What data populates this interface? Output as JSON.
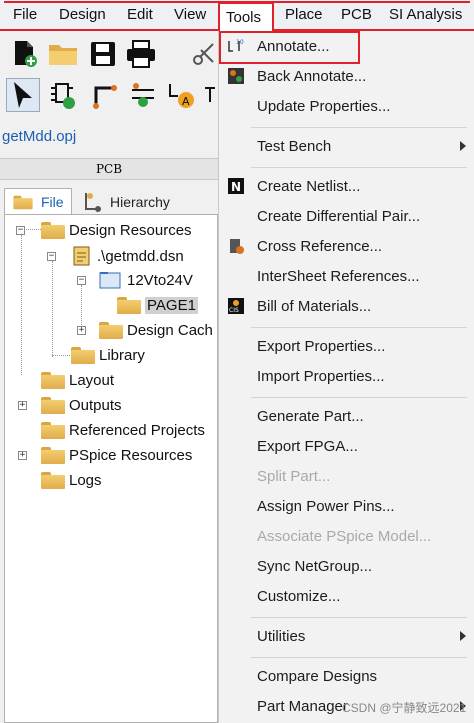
{
  "menubar": {
    "items": [
      "File",
      "Design",
      "Edit",
      "View",
      "Tools",
      "Place",
      "PCB",
      "SI Analysis"
    ]
  },
  "project": {
    "title": "getMdd.opj"
  },
  "panel": {
    "header": "PCB",
    "tabs": {
      "file": "File",
      "hierarchy": "Hierarchy"
    }
  },
  "tree": {
    "design_resources": "Design Resources",
    "dsn": ".\\getmdd.dsn",
    "schematic": "12Vto24V",
    "page": "PAGE1",
    "design_cache": "Design Cach",
    "library": "Library",
    "layout": "Layout",
    "outputs": "Outputs",
    "referenced_projects": "Referenced Projects",
    "pspice_resources": "PSpice Resources",
    "logs": "Logs"
  },
  "tools_menu": {
    "annotate": "Annotate...",
    "back_annotate": "Back Annotate...",
    "update_properties": "Update Properties...",
    "test_bench": "Test Bench",
    "create_netlist": "Create Netlist...",
    "create_diff_pair": "Create Differential Pair...",
    "cross_reference": "Cross Reference...",
    "intersheet_refs": "InterSheet References...",
    "bill_of_materials": "Bill of Materials...",
    "export_properties": "Export Properties...",
    "import_properties": "Import Properties...",
    "generate_part": "Generate Part...",
    "export_fpga": "Export FPGA...",
    "split_part": "Split Part...",
    "assign_power_pins": "Assign Power Pins...",
    "associate_pspice": "Associate PSpice Model...",
    "sync_netgroup": "Sync NetGroup...",
    "customize": "Customize...",
    "utilities": "Utilities",
    "compare_designs": "Compare Designs",
    "part_manager": "Part Manager"
  },
  "watermark": "CSDN @宁静致远2021",
  "colors": {
    "highlight_red": "#e0202a",
    "link_blue": "#1a5fb4",
    "folder": "#f3cd6f"
  }
}
